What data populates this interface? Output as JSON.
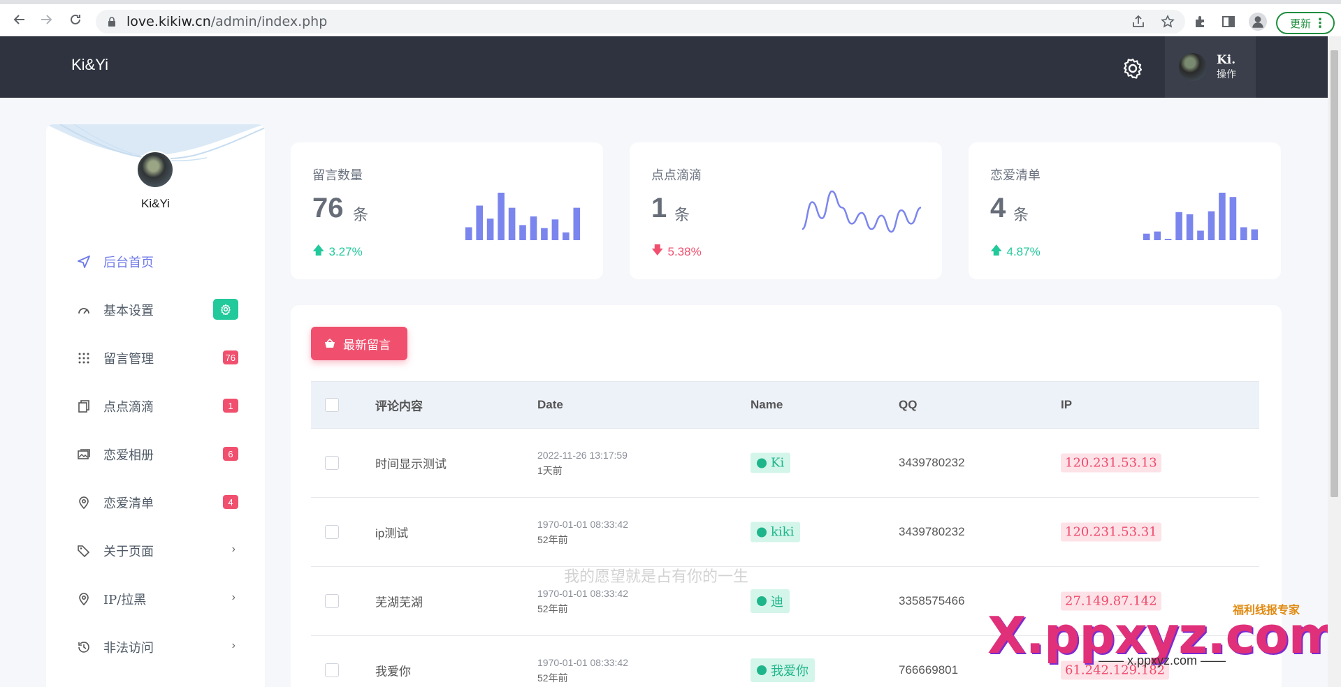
{
  "browser": {
    "url_host": "love.kikiw.cn",
    "url_path": "/admin/index.php",
    "update_label": "更新"
  },
  "header": {
    "brand": "Ki&Yi",
    "user_name": "Ki.",
    "user_role": "操作"
  },
  "sidebar": {
    "profile_name": "Ki&Yi",
    "items": [
      {
        "label": "后台首页",
        "icon": "navigation-icon"
      },
      {
        "label": "基本设置",
        "icon": "dashboard-gauge-icon"
      },
      {
        "label": "留言管理",
        "icon": "grid-icon",
        "badge": "76"
      },
      {
        "label": "点点滴滴",
        "icon": "documents-icon",
        "badge": "1"
      },
      {
        "label": "恋爱相册",
        "icon": "photos-icon",
        "badge": "6"
      },
      {
        "label": "恋爱清单",
        "icon": "location-pin-icon",
        "badge": "4"
      },
      {
        "label": "关于页面",
        "icon": "tags-icon"
      },
      {
        "label": "IP/拉黑",
        "icon": "location-pin-icon"
      },
      {
        "label": "非法访问",
        "icon": "history-icon"
      }
    ]
  },
  "stats": [
    {
      "title": "留言数量",
      "value": "76",
      "unit": "条",
      "trend": "3.27%",
      "direction": "up",
      "spark": [
        3,
        8,
        5,
        11,
        7.5,
        3.5,
        5.5,
        2.8,
        4.8,
        1.8,
        7.5
      ]
    },
    {
      "title": "点点滴滴",
      "value": "1",
      "unit": "条",
      "trend": "5.38%",
      "direction": "down",
      "spark": [
        2,
        7,
        4,
        9,
        6,
        3,
        5,
        2,
        4.5,
        1.5,
        5.5,
        3,
        6
      ]
    },
    {
      "title": "恋爱清单",
      "value": "4",
      "unit": "条",
      "trend": "4.87%",
      "direction": "up",
      "spark": [
        1.5,
        2,
        0.3,
        6.5,
        6,
        2.2,
        6.7,
        11,
        10,
        3,
        2.5
      ]
    }
  ],
  "table": {
    "button_label": "最新留言",
    "headers": {
      "content": "评论内容",
      "date": "Date",
      "name": "Name",
      "qq": "QQ",
      "ip": "IP"
    },
    "rows": [
      {
        "content": "时间显示测试",
        "date": "2022-11-26 13:17:59",
        "relative": "1天前",
        "name": "Ki",
        "qq": "3439780232",
        "ip": "120.231.53.13"
      },
      {
        "content": "ip测试",
        "date": "1970-01-01 08:33:42",
        "relative": "52年前",
        "name": "kiki",
        "qq": "3439780232",
        "ip": "120.231.53.31"
      },
      {
        "content": "芜湖芜湖",
        "date": "1970-01-01 08:33:42",
        "relative": "52年前",
        "name": "迪",
        "qq": "3358575466",
        "ip": "27.149.87.142"
      },
      {
        "content": "我爱你",
        "date": "1970-01-01 08:33:42",
        "relative": "52年前",
        "name": "我爱你",
        "qq": "766669801",
        "ip": "61.242.129.182"
      }
    ]
  },
  "overlay_text": "我的愿望就是占有你的一生",
  "watermark": {
    "logo": "X.ppxyz.com",
    "tag": "福利线报专家",
    "small": "—— x.ppxyz.com ——"
  },
  "colors": {
    "accent": "#6d78e8",
    "danger": "#f0506e",
    "success": "#22c99a",
    "header_bg": "#2e333f"
  }
}
